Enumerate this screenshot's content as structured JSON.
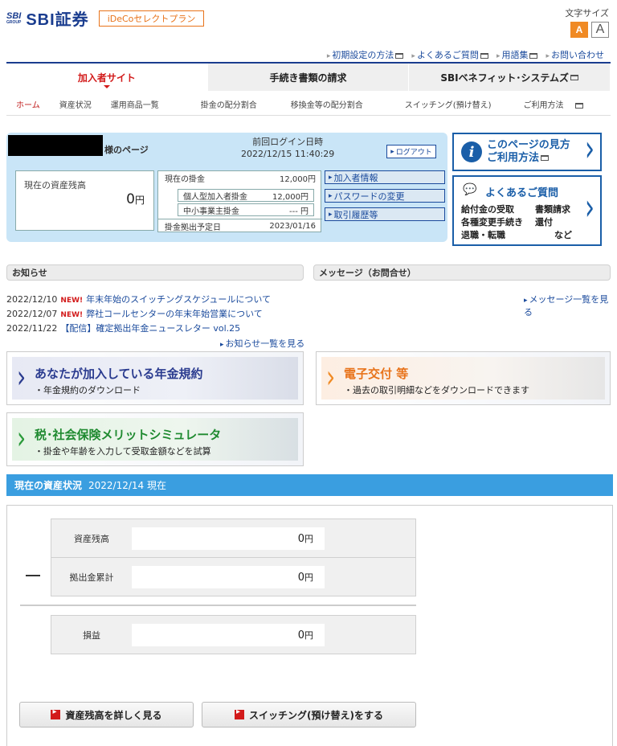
{
  "header": {
    "logo_small": "SBI",
    "logo_small_sub": "GROUP",
    "logo_main": "SBI証券",
    "plan_badge": "iDeCoセレクトプラン",
    "font_size_label": "文字サイズ",
    "font_size_large": "A",
    "font_size_small": "A"
  },
  "top_links": [
    "初期設定の方法",
    "よくあるご質問",
    "用語集",
    "お問い合わせ"
  ],
  "nav": {
    "tabs": [
      "加入者サイト",
      "手続き書類の請求",
      "SBIベネフィット･システムズ"
    ]
  },
  "subnav": [
    "ホーム",
    "資産状況",
    "運用商品一覧",
    "掛金の配分割合",
    "移換金等の配分割合",
    "スイッチング(預け替え)",
    "ご利用方法"
  ],
  "account": {
    "sama_label": "様のページ",
    "last_login_label": "前回ログイン日時",
    "last_login_value": "2022/12/15 11:40:29",
    "logout_label": "ログアウト",
    "balance_label": "現在の資産残高",
    "balance_value": "0",
    "balance_unit": "円",
    "contrib_label": "現在の掛金",
    "contrib_value": "12,000円",
    "personal_label": "個人型加入者掛金",
    "personal_value": "12,000円",
    "employer_label": "中小事業主掛金",
    "employer_value": "--- 円",
    "schedule_label": "掛金拠出予定日",
    "schedule_value": "2023/01/16",
    "buttons": [
      "加入者情報",
      "パスワードの変更",
      "取引履歴等"
    ]
  },
  "help": {
    "guide_line1": "このページの見方",
    "guide_line2": "ご利用方法",
    "faq_title": "よくあるご質問",
    "faq_items": [
      "給付金の受取",
      "書類請求",
      "各種変更手続き",
      "還付",
      "退職・転職",
      "など"
    ]
  },
  "notices": {
    "title": "お知らせ",
    "items": [
      {
        "date": "2022/12/10",
        "new": "NEW!",
        "text": "年末年始のスイッチングスケジュールについて"
      },
      {
        "date": "2022/12/07",
        "new": "NEW!",
        "text": "弊社コールセンターの年末年始営業について"
      },
      {
        "date": "2022/11/22",
        "new": "",
        "text": "【配信】確定拠出年金ニュースレター vol.25"
      }
    ],
    "more": "お知らせ一覧を見る"
  },
  "messages": {
    "title": "メッセージ（お問合せ）",
    "more": "メッセージ一覧を見る"
  },
  "banners": {
    "pension_title": "あなたが加入している年金規約",
    "pension_sub": "・年金規約のダウンロード",
    "edelivery_title": "電子交付 等",
    "edelivery_sub": "・過去の取引明細などをダウンロードできます",
    "sim_title": "税･社会保険メリットシミュレータ",
    "sim_sub": "・掛金や年齢を入力して受取金額などを試算"
  },
  "asset_status": {
    "title": "現在の資産状況",
    "as_of": "2022/12/14 現在",
    "rows": [
      {
        "label": "資産残高",
        "value": "0",
        "unit": "円"
      },
      {
        "label": "拠出金累計",
        "value": "0",
        "unit": "円"
      },
      {
        "label": "損益",
        "value": "0",
        "unit": "円"
      }
    ],
    "btn_detail": "資産残高を詳しく見る",
    "btn_switch": "スイッチング(預け替え)をする"
  },
  "colors": {
    "brand": "#1a3d8f",
    "accent_orange": "#e8731a",
    "red": "#d21a1a",
    "panel_blue": "#c9e5f7",
    "asset_bar": "#3a9ee0"
  }
}
